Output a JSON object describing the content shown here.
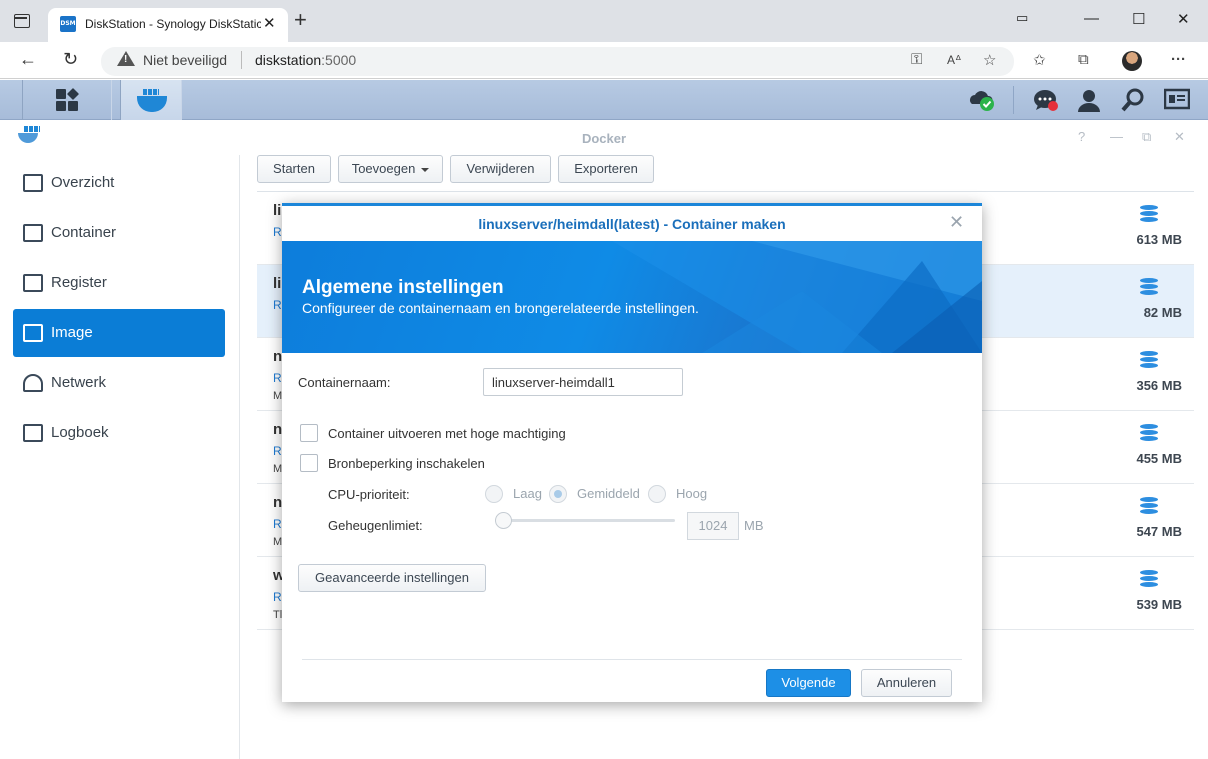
{
  "browser": {
    "tab_title": "DiskStation - Synology DiskStatic",
    "favicon_text": "DSM",
    "security_label": "Niet beveiligd",
    "url_host": "diskstation",
    "url_port": ":5000"
  },
  "app": {
    "title": "Docker"
  },
  "toolbar": {
    "start": "Starten",
    "add": "Toevoegen",
    "remove": "Verwijderen",
    "export": "Exporteren"
  },
  "sidebar": {
    "items": [
      {
        "label": "Overzicht",
        "icon": "overview-icon"
      },
      {
        "label": "Container",
        "icon": "container-icon"
      },
      {
        "label": "Register",
        "icon": "registry-icon"
      },
      {
        "label": "Image",
        "icon": "image-icon"
      },
      {
        "label": "Netwerk",
        "icon": "network-icon"
      },
      {
        "label": "Logboek",
        "icon": "log-icon"
      }
    ],
    "active_index": 3
  },
  "images": {
    "rows": [
      {
        "name": "li",
        "repo": "R",
        "desc": "",
        "size": "613 MB"
      },
      {
        "name": "li",
        "repo": "R",
        "desc": "",
        "size": "82 MB"
      },
      {
        "name": "n",
        "repo": "R",
        "desc": "M",
        "size": "356 MB"
      },
      {
        "name": "n",
        "repo": "R",
        "desc": "M",
        "size": "455 MB"
      },
      {
        "name": "n",
        "repo": "R",
        "desc": "M",
        "size": "547 MB"
      },
      {
        "name": "w",
        "repo": "R",
        "desc": "Tl",
        "size": "539 MB"
      }
    ]
  },
  "dialog": {
    "title": "linuxserver/heimdall(latest) - Container maken",
    "banner_title": "Algemene instellingen",
    "banner_subtitle": "Configureer de containernaam en brongerelateerde instellingen.",
    "container_name_label": "Containernaam:",
    "container_name_value": "linuxserver-heimdall1",
    "privileged_label": "Container uitvoeren met hoge machtiging",
    "resource_limit_label": "Bronbeperking inschakelen",
    "cpu_priority_label": "CPU-prioriteit:",
    "cpu_options": [
      "Laag",
      "Gemiddeld",
      "Hoog"
    ],
    "cpu_selected": "Gemiddeld",
    "memory_limit_label": "Geheugenlimiet:",
    "memory_value": "1024",
    "memory_unit": "MB",
    "advanced_button": "Geavanceerde instellingen",
    "next_button": "Volgende",
    "cancel_button": "Annuleren"
  },
  "colors": {
    "accent": "#0b7dd6",
    "banner": "#0f8be6",
    "taskbar": "#b7cae3"
  }
}
